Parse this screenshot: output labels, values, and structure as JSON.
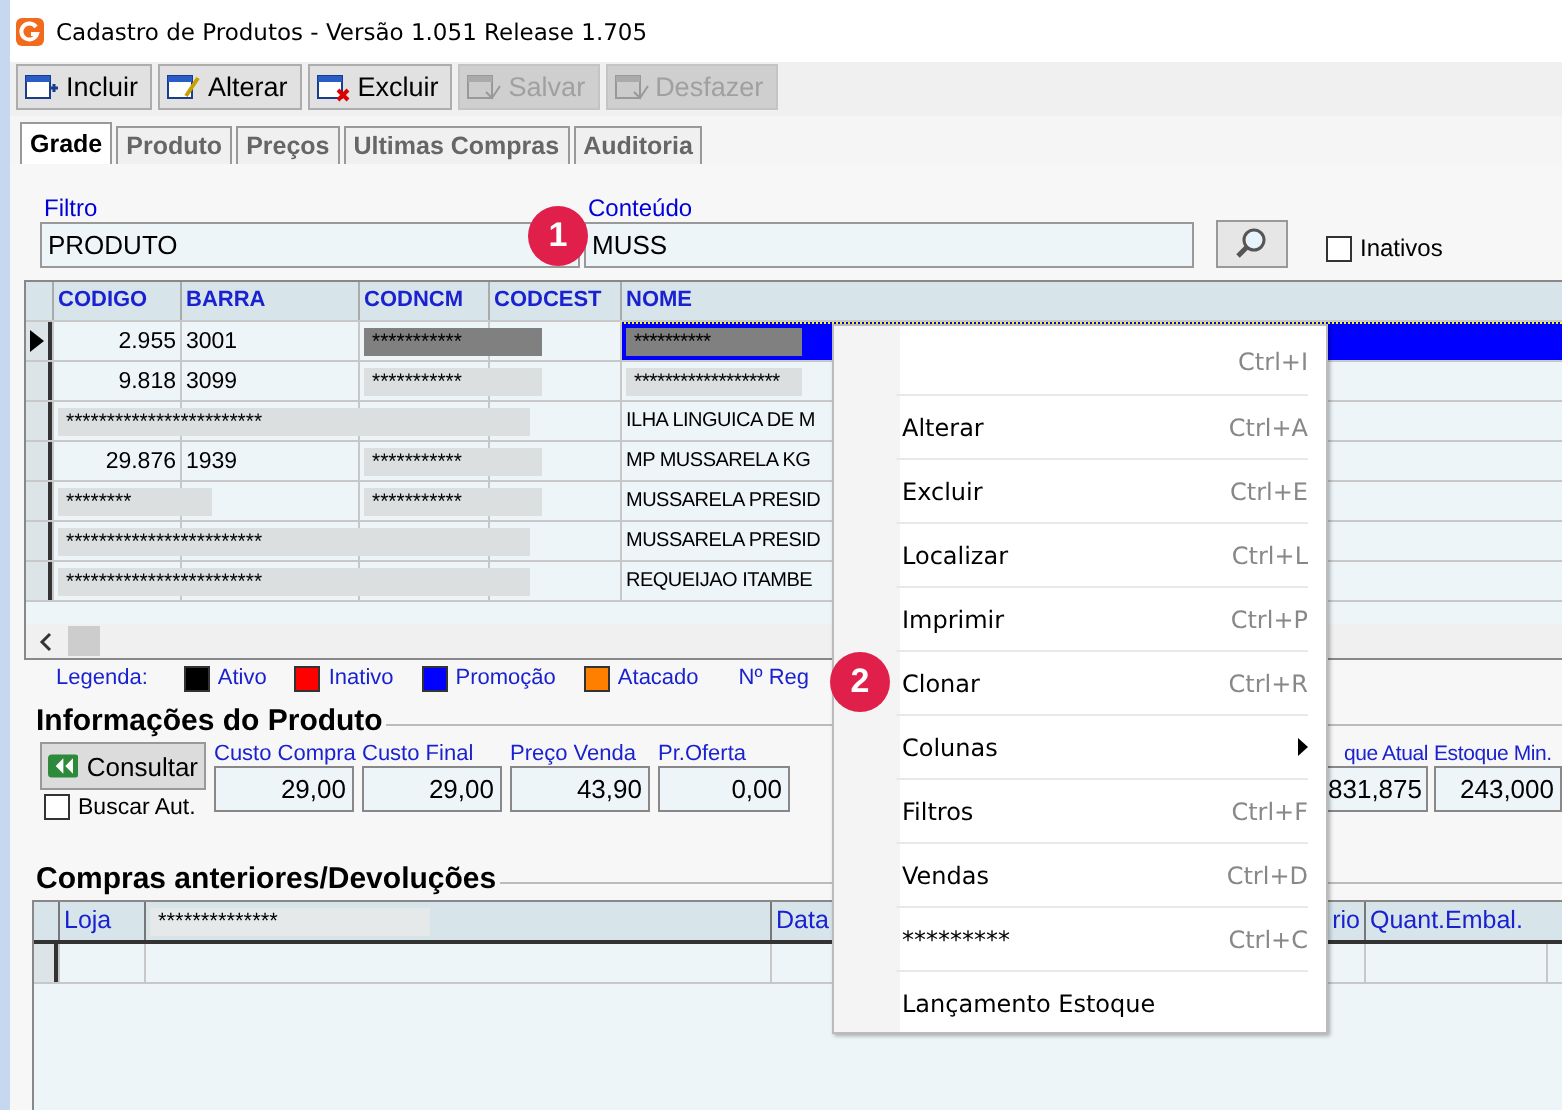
{
  "window": {
    "title": "Cadastro de Produtos - Versão 1.051 Release 1.705"
  },
  "toolbar": [
    {
      "label": "Incluir",
      "disabled": false
    },
    {
      "label": "Alterar",
      "disabled": false
    },
    {
      "label": "Excluir",
      "disabled": false
    },
    {
      "label": "Salvar",
      "disabled": true
    },
    {
      "label": "Desfazer",
      "disabled": true
    }
  ],
  "tabs": [
    {
      "label": "Grade",
      "selected": true
    },
    {
      "label": "Produto",
      "selected": false
    },
    {
      "label": "Preços",
      "selected": false
    },
    {
      "label": "Ultimas Compras",
      "selected": false
    },
    {
      "label": "Auditoria",
      "selected": false
    }
  ],
  "filter": {
    "label": "Filtro",
    "value": "PRODUTO"
  },
  "content": {
    "label": "Conteúdo",
    "value": "MUSS"
  },
  "inactive": {
    "label": "Inativos",
    "checked": false
  },
  "grid": {
    "columns": [
      "CODIGO",
      "BARRA",
      "CODNCM",
      "CODCEST",
      "NOME"
    ],
    "rows": [
      {
        "selected": true,
        "cells": [
          {
            "kind": "number",
            "text": "2.955"
          },
          {
            "kind": "text",
            "text": "3001"
          },
          {
            "kind": "masked",
            "text": "***********"
          },
          {
            "kind": "empty"
          },
          {
            "kind": "name_masked",
            "text": "**********"
          }
        ]
      },
      {
        "selected": false,
        "cells": [
          {
            "kind": "number",
            "text": "9.818"
          },
          {
            "kind": "text",
            "text": "3099"
          },
          {
            "kind": "masked",
            "text": "***********"
          },
          {
            "kind": "empty"
          },
          {
            "kind": "name_masked",
            "text": "*******************"
          }
        ]
      },
      {
        "selected": false,
        "cells": [
          {
            "kind": "masked_wide",
            "text": "************************"
          },
          {
            "kind": "empty"
          },
          {
            "kind": "empty"
          },
          {
            "kind": "empty"
          },
          {
            "kind": "name",
            "text": "ILHA LINGUICA DE M"
          }
        ]
      },
      {
        "selected": false,
        "cells": [
          {
            "kind": "number",
            "text": "29.876"
          },
          {
            "kind": "text",
            "text": "1939"
          },
          {
            "kind": "masked",
            "text": "***********"
          },
          {
            "kind": "empty"
          },
          {
            "kind": "name",
            "text": "MP MUSSARELA KG"
          }
        ]
      },
      {
        "selected": false,
        "cells": [
          {
            "kind": "masked",
            "text": "********"
          },
          {
            "kind": "empty"
          },
          {
            "kind": "masked",
            "text": "***********"
          },
          {
            "kind": "empty"
          },
          {
            "kind": "name",
            "text": "MUSSARELA PRESID"
          }
        ]
      },
      {
        "selected": false,
        "cells": [
          {
            "kind": "masked_wide",
            "text": "************************"
          },
          {
            "kind": "empty"
          },
          {
            "kind": "empty"
          },
          {
            "kind": "empty"
          },
          {
            "kind": "name",
            "text": "MUSSARELA PRESID"
          }
        ]
      },
      {
        "selected": false,
        "cells": [
          {
            "kind": "masked_wide",
            "text": "************************"
          },
          {
            "kind": "empty"
          },
          {
            "kind": "empty"
          },
          {
            "kind": "empty"
          },
          {
            "kind": "name",
            "text": "REQUEIJAO ITAMBE"
          }
        ]
      }
    ]
  },
  "legend": {
    "label": "Legenda:",
    "items": [
      {
        "label": "Ativo",
        "color": "#000000"
      },
      {
        "label": "Inativo",
        "color": "#ff0000"
      },
      {
        "label": "Promoção",
        "color": "#0000ff"
      },
      {
        "label": "Atacado",
        "color": "#ff8000"
      }
    ],
    "count_label": "Nº Reg"
  },
  "product_info": {
    "title": "Informações do Produto",
    "button": "Consultar",
    "auto_search": {
      "label": "Buscar Aut.",
      "checked": false
    },
    "fields": [
      {
        "label": "Custo Compra",
        "value": "29,00"
      },
      {
        "label": "Custo Final",
        "value": "29,00"
      },
      {
        "label": "Preço Venda",
        "value": "43,90"
      },
      {
        "label": "Pr.Oferta",
        "value": "0,00"
      }
    ],
    "fields_right": [
      {
        "label": "que Atual",
        "value": "831,875"
      },
      {
        "label": "Estoque Min.",
        "value": "243,000"
      }
    ]
  },
  "purchases": {
    "title": "Compras anteriores/Devoluções",
    "columns": [
      {
        "kind": "text",
        "label": "Loja"
      },
      {
        "kind": "masked",
        "label": "**************"
      },
      {
        "kind": "text",
        "label": "Data"
      },
      {
        "kind": "text",
        "label": "rio"
      },
      {
        "kind": "text",
        "label": "Quant.Embal."
      }
    ]
  },
  "context_menu": [
    {
      "shortcut": "Ctrl+I",
      "submenu": false
    },
    {
      "label": "Alterar",
      "shortcut": "Ctrl+A",
      "submenu": false
    },
    {
      "label": "Excluir",
      "shortcut": "Ctrl+E",
      "submenu": false
    },
    {
      "label": "Localizar",
      "shortcut": "Ctrl+L",
      "submenu": false
    },
    {
      "label": "Imprimir",
      "shortcut": "Ctrl+P",
      "submenu": false
    },
    {
      "label": "Clonar",
      "shortcut": "Ctrl+R",
      "submenu": false
    },
    {
      "label": "Colunas",
      "submenu": true
    },
    {
      "label": "Filtros",
      "shortcut": "Ctrl+F",
      "submenu": false
    },
    {
      "label": "Vendas",
      "shortcut": "Ctrl+D",
      "submenu": false
    },
    {
      "label": "*********",
      "shortcut": "Ctrl+C",
      "submenu": false
    },
    {
      "label": "Lançamento Estoque",
      "submenu": false
    }
  ],
  "callouts": [
    "1",
    "2"
  ]
}
